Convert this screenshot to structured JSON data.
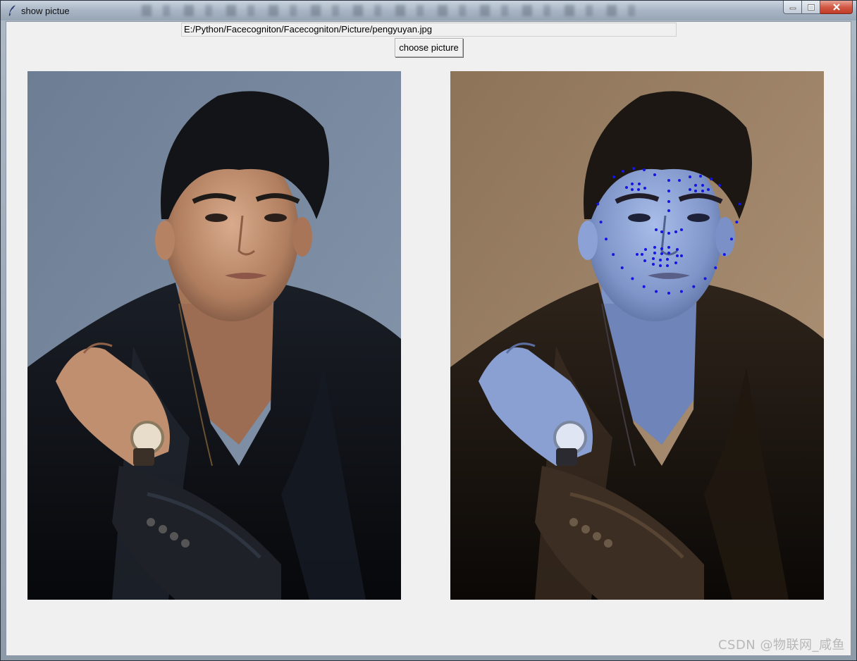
{
  "window": {
    "title": "show pictue",
    "icon": "feather-icon"
  },
  "controls": {
    "path_value": "E:/Python/Facecogniton/Facecogniton/Picture/pengyuyan.jpg",
    "choose_button_label": "choose picture"
  },
  "images": {
    "original": {
      "description_icon": "portrait-photo"
    },
    "processed": {
      "landmark_color": "#1414e6",
      "tint": "#9fb3e6"
    }
  },
  "watermark": "CSDN @物联网_咸鱼"
}
